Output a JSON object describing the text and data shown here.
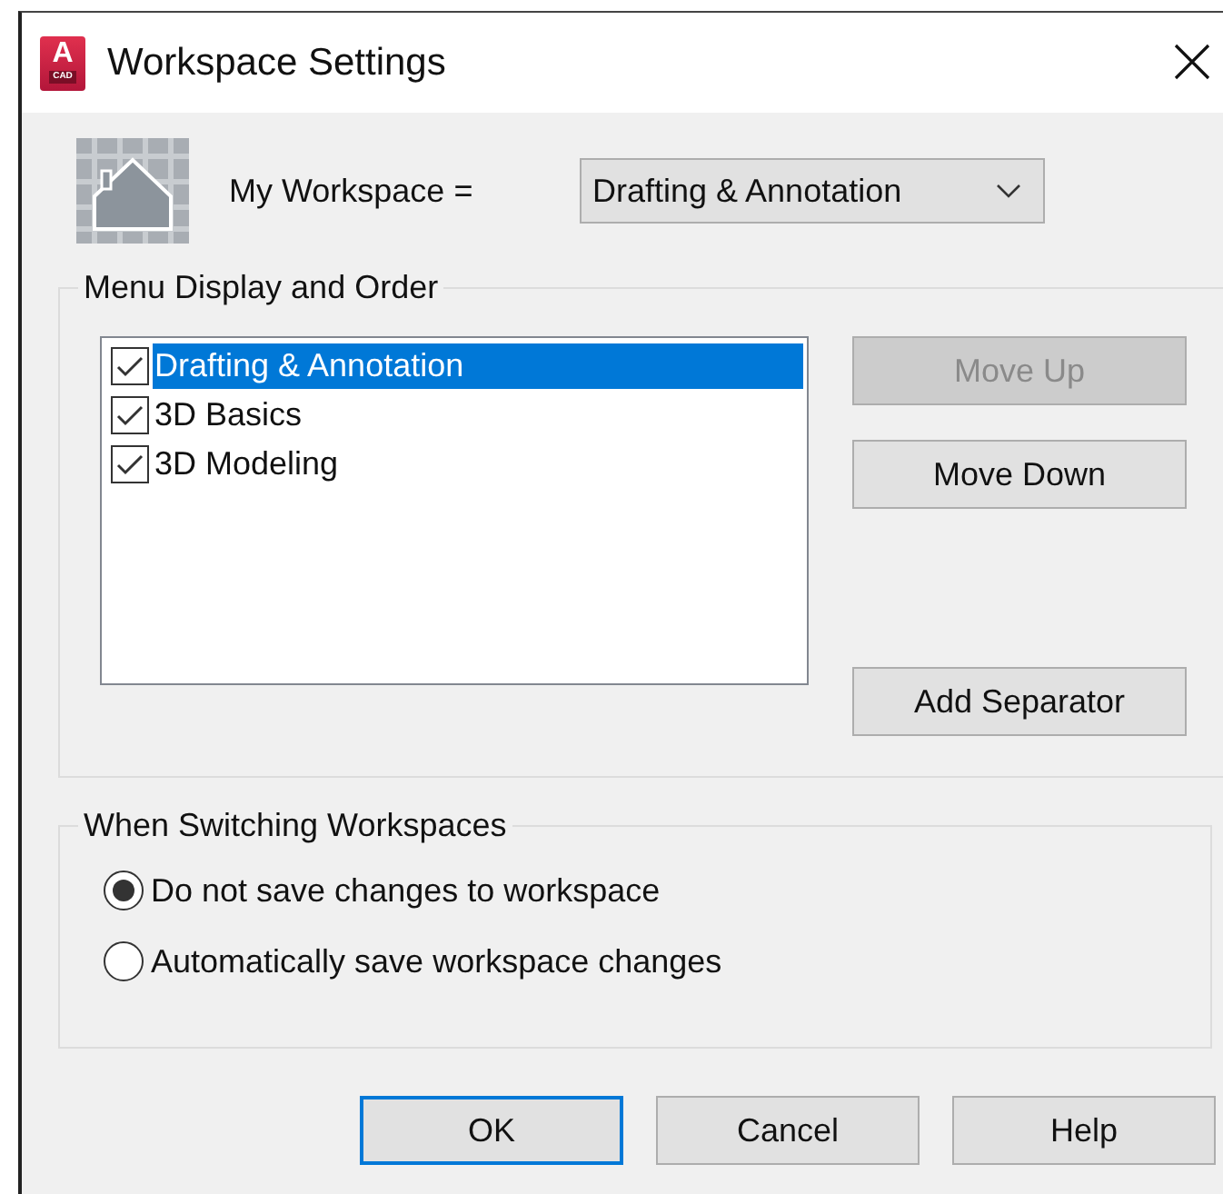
{
  "window": {
    "title": "Workspace Settings",
    "app_icon": {
      "letter": "A",
      "caption": "CAD"
    }
  },
  "workspace": {
    "label": "My Workspace =",
    "value": "Drafting & Annotation"
  },
  "menu_group": {
    "title": "Menu Display and Order",
    "items": [
      {
        "label": "Drafting & Annotation",
        "checked": true,
        "selected": true
      },
      {
        "label": "3D Basics",
        "checked": true,
        "selected": false
      },
      {
        "label": "3D Modeling",
        "checked": true,
        "selected": false
      }
    ],
    "buttons": [
      {
        "label": "Move Up",
        "disabled": true
      },
      {
        "label": "Move Down",
        "disabled": false
      },
      {
        "label": "Add Separator",
        "disabled": false
      }
    ]
  },
  "switch_group": {
    "title": "When Switching Workspaces",
    "options": [
      {
        "label": "Do not save changes to workspace",
        "selected": true
      },
      {
        "label": "Automatically save workspace changes",
        "selected": false
      }
    ]
  },
  "buttons": [
    {
      "label": "OK",
      "default": true
    },
    {
      "label": "Cancel",
      "default": false
    },
    {
      "label": "Help",
      "default": false
    }
  ]
}
